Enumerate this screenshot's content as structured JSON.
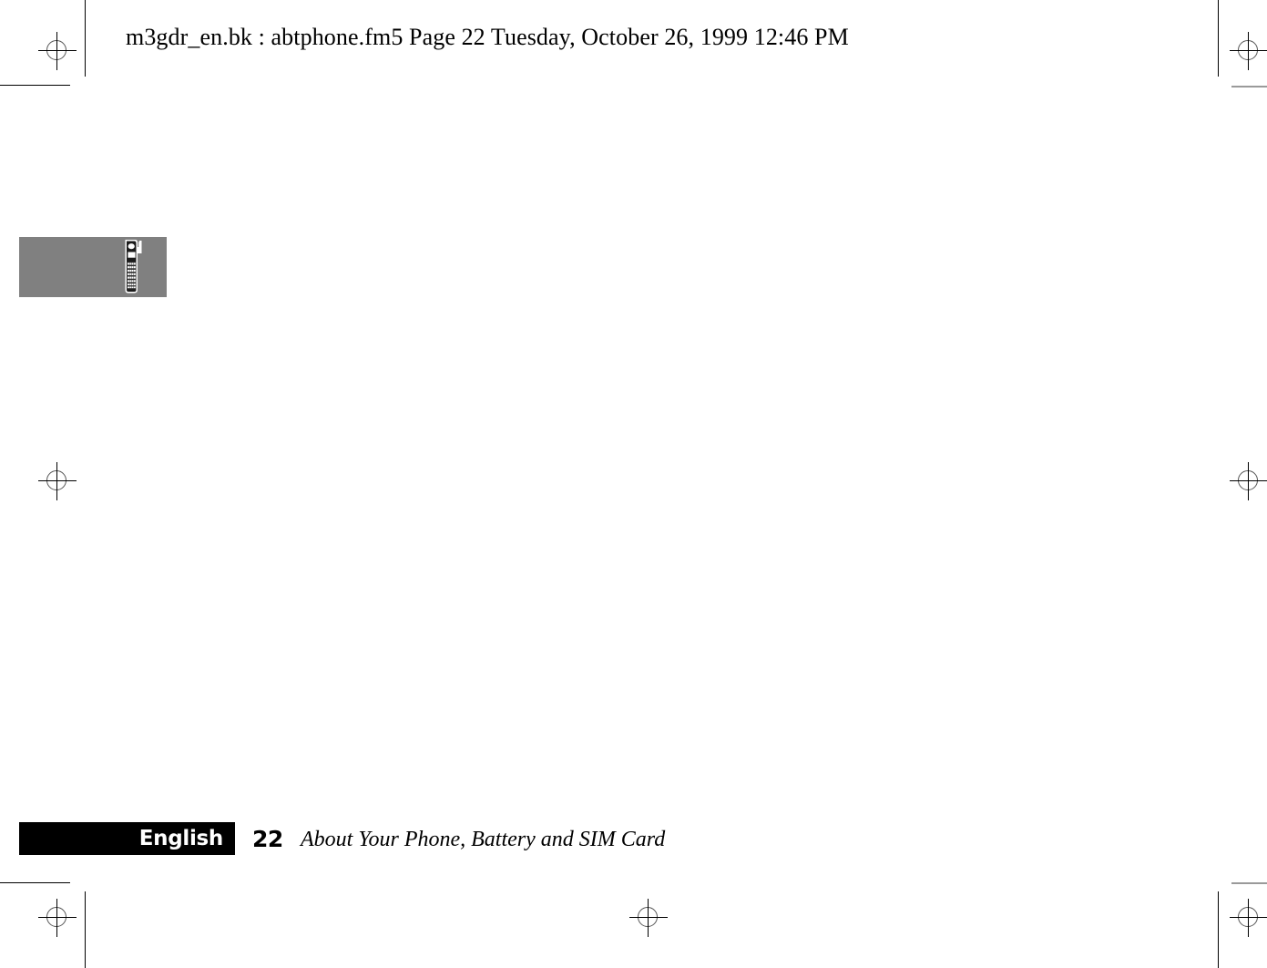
{
  "header": {
    "file_info": "m3gdr_en.bk : abtphone.fm5  Page 22  Tuesday, October 26, 1999  12:46 PM"
  },
  "figure": {
    "icon_name": "cordless-phone-icon",
    "background_color": "#808080"
  },
  "footer": {
    "language": "English",
    "page_number": "22",
    "chapter_title": "About Your Phone, Battery and SIM Card",
    "bar_color": "#000000",
    "language_text_color": "#ffffff"
  },
  "printer_marks": {
    "registration_name": "registration-target",
    "crop_name": "crop-mark",
    "color": "#000000",
    "light_color": "#9a9a9a"
  }
}
